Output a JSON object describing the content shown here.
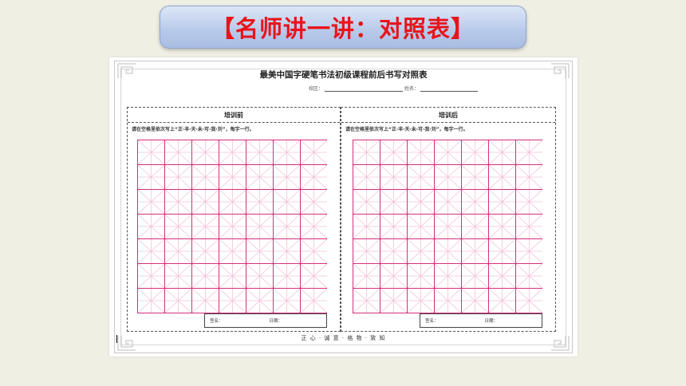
{
  "header": {
    "title": "【名师讲一讲：对照表】"
  },
  "sheet": {
    "title": "最美中国字硬笔书法初级课程前后书写对照表",
    "campus_label": "校区：",
    "name_label": "姓名：",
    "panels": [
      {
        "heading": "培训前",
        "instruction": "请在空格里依次写上“正·丰·天·未·可·我·刘”，每字一行。",
        "sign_label": "签名：",
        "date_label": "日期："
      },
      {
        "heading": "培训后",
        "instruction": "请在空格里依次写上“正·丰·天·未·可·我·刘”，每字一行。",
        "sign_label": "签名：",
        "date_label": "日期："
      }
    ],
    "motto": "正 心 · 诚 意 · 格 物 · 致 知"
  },
  "colors": {
    "title_red": "#e8141b",
    "grid_pink": "#d4307a",
    "grid_guide": "#f3c2da"
  }
}
